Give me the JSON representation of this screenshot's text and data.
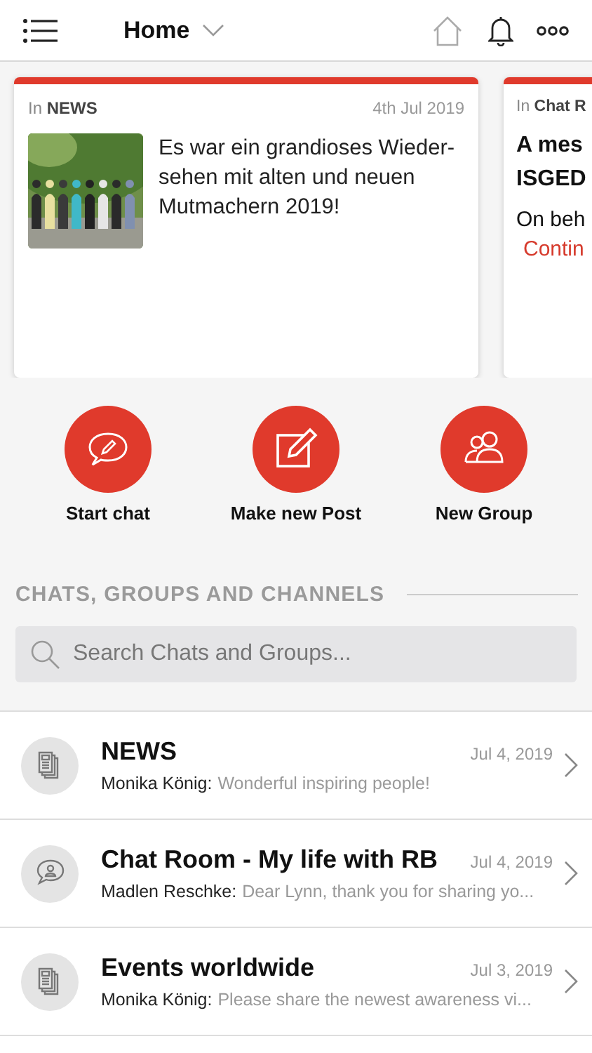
{
  "header": {
    "title": "Home"
  },
  "cards": [
    {
      "kind": "post",
      "in": "In",
      "channel": "NEWS",
      "date": "4th Jul 2019",
      "text": "Es war ein grandioses Wieder-sehen mit alten und neuen Mutmachern 2019!"
    },
    {
      "kind": "message",
      "in": "In",
      "channel": "Chat R",
      "title_lines": [
        "A mes",
        "ISGED"
      ],
      "body": "On beh",
      "link": "Contin"
    }
  ],
  "actions": [
    {
      "kind": "chat",
      "label": "Start chat"
    },
    {
      "kind": "post",
      "label": "Make new Post"
    },
    {
      "kind": "group",
      "label": "New Group"
    }
  ],
  "section": {
    "title": "CHATS, GROUPS AND CHANNELS"
  },
  "search": {
    "placeholder": "Search Chats and Groups..."
  },
  "chats": [
    {
      "kind": "news",
      "title": "NEWS",
      "date": "Jul 4, 2019",
      "author": "Monika König:",
      "message": "Wonderful inspiring people!"
    },
    {
      "kind": "chat",
      "title": "Chat Room - My life with RB",
      "date": "Jul 4, 2019",
      "author": "Madlen Reschke:",
      "message": "Dear Lynn, thank you for sharing yo..."
    },
    {
      "kind": "news",
      "title": "Events worldwide",
      "date": "Jul 3, 2019",
      "author": "Monika König:",
      "message": "Please share the newest awareness vi..."
    }
  ]
}
